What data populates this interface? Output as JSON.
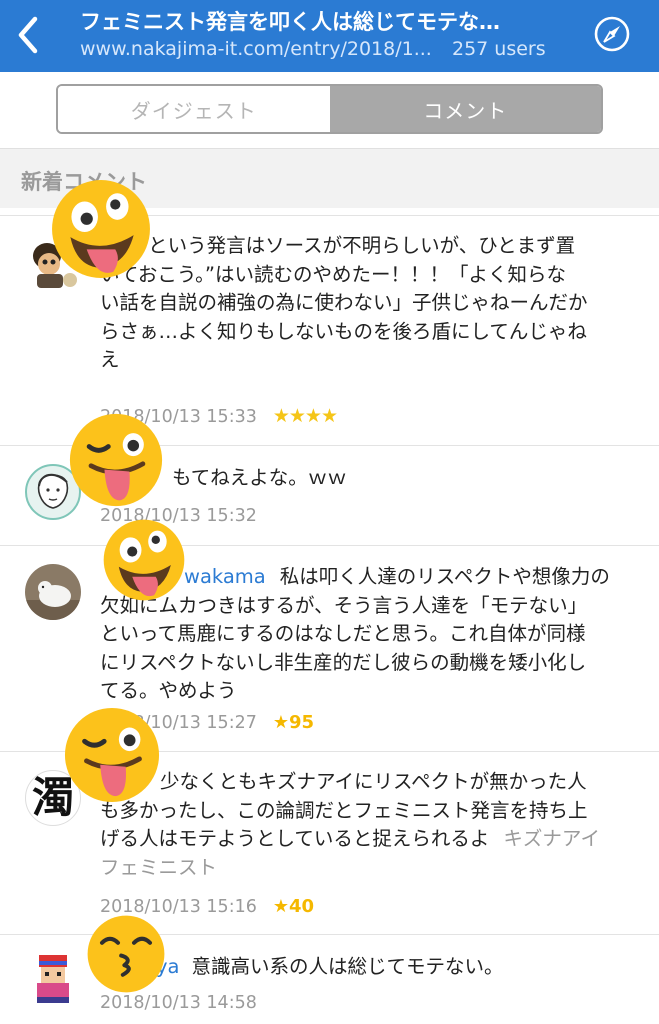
{
  "header": {
    "title": "フェミニスト発言を叩く人は総じてモテな…",
    "url": "www.nakajima-it.com/entry/2018/1...",
    "users": "257 users",
    "back_icon": "chevron-left-icon",
    "compass_icon": "compass-icon"
  },
  "tabs": [
    {
      "label": "ダイジェスト",
      "active": false
    },
    {
      "label": "コメント",
      "active": true
    }
  ],
  "section": {
    "title": "新着コメント"
  },
  "comments": [
    {
      "lines": [
        "“という発言はソースが不明らしいが、ひとまず置",
        "いておこう。”はい読むのやめたー！！！「よく知らな",
        "い話を自説の補強の為に使わない」子供じゃねーんだか",
        "らさぁ…よく知りもしないものを後ろ盾にしてんじゃね",
        "え"
      ],
      "date": "2018/10/13 15:33",
      "stars": "★★★★"
    },
    {
      "lines": [
        "もてねえよな。ｗｗ"
      ],
      "date": "2018/10/13 15:32"
    },
    {
      "user": "wakama",
      "lines": [
        "私は叩く人達のリスペクトや想像力の",
        "欠如にムカつきはするが、そう言う人達を「モテない」",
        "といって馬鹿にするのはなしだと思う。これ自体が同様",
        "にリスペクトないし非生産的だし彼らの動機を矮小化し",
        "てる。やめよう"
      ],
      "date": "2018/10/13 15:27",
      "count": "95"
    },
    {
      "lines": [
        "少なくともキズナアイにリスペクトが無かった人",
        "も多かったし、この論調だとフェミニスト発言を持ち上",
        "げる人はモテようとしていると捉えられるよ"
      ],
      "tag1": "キズナアイ",
      "tag2": "フェミニスト",
      "date": "2018/10/13 15:16",
      "count": "40"
    },
    {
      "user": "ya",
      "lines": [
        "意識高い系の人は総じてモテない。"
      ],
      "date": "2018/10/13 14:58"
    }
  ],
  "avatars": {
    "a4_char": "濁"
  },
  "colors": {
    "header_bg": "#2b7bd3",
    "star": "#f5c518",
    "username": "#2b7bd3",
    "emoji_face": "#fcc21b"
  }
}
